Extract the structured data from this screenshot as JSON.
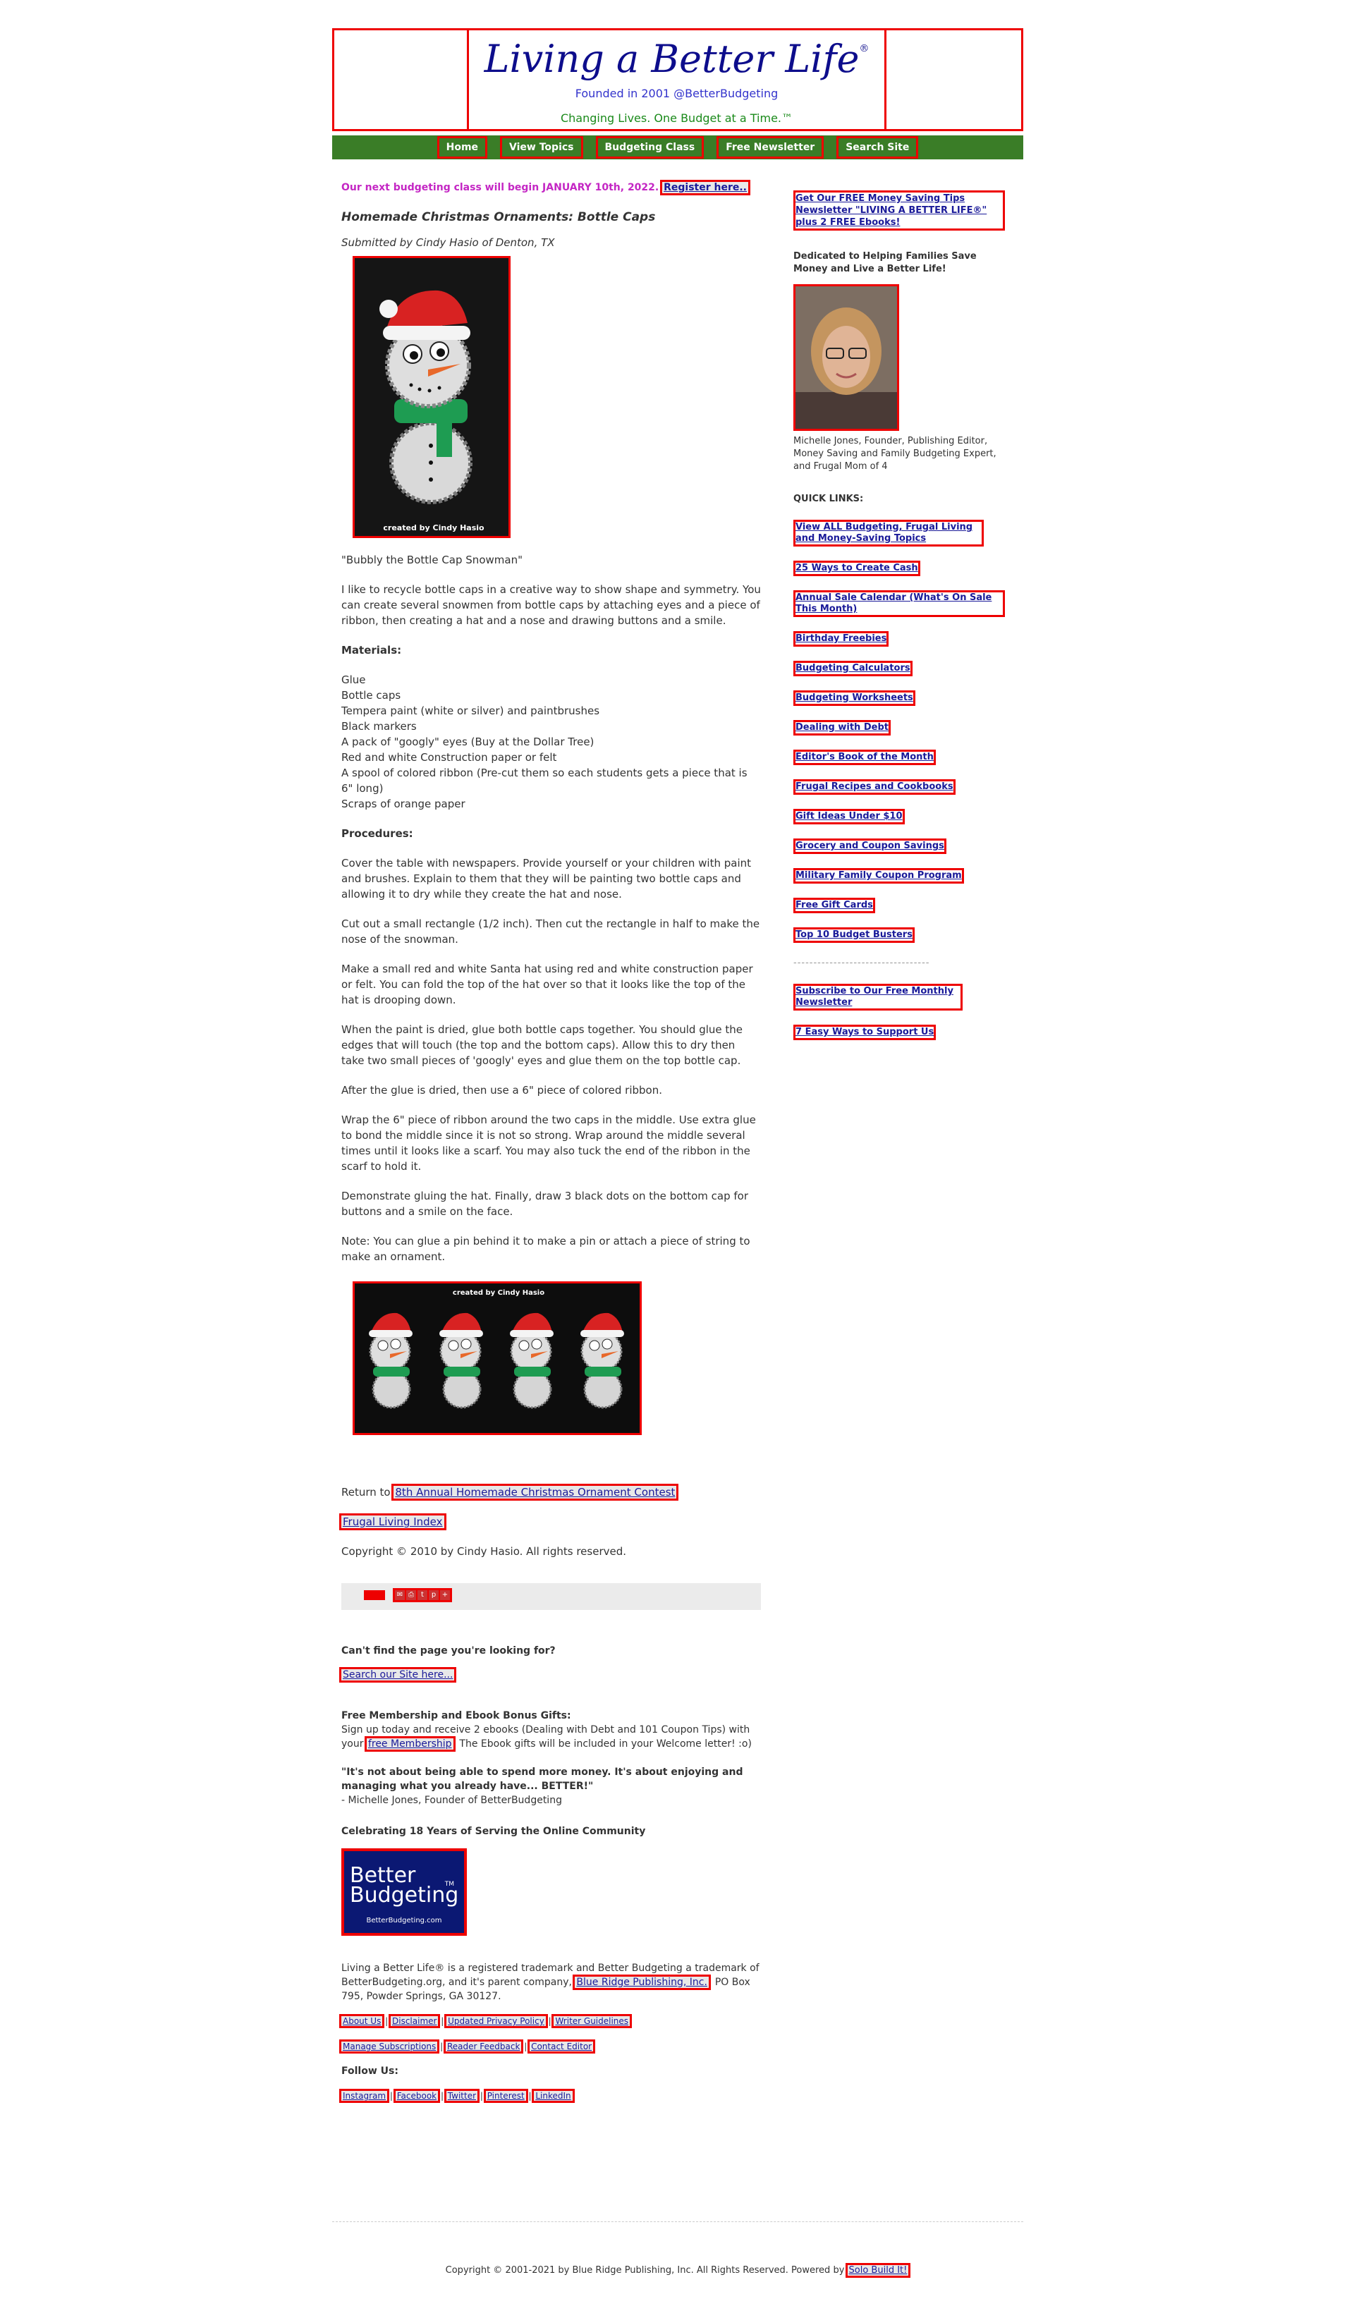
{
  "header": {
    "title": "Living a Better Life",
    "registered": "®",
    "founded": "Founded in 2001 @BetterBudgeting",
    "tagline": "Changing Lives. One Budget at a Time.™"
  },
  "nav": [
    "Home",
    "View Topics",
    "Budgeting Class",
    "Free Newsletter",
    "Search Site"
  ],
  "main": {
    "class_note": "Our next budgeting class will begin JANUARY 10th, 2022.",
    "register_link": "Register here..",
    "article_title": "Homemade Christmas Ornaments: Bottle Caps",
    "submitted": "Submitted by Cindy Hasio of Denton, TX",
    "photo1_caption": "created by Cindy Hasio",
    "intro_quote": "\"Bubbly the Bottle Cap Snowman\"",
    "intro": "I like to recycle bottle caps in a creative way to show shape and symmetry.  You can create several snowmen from bottle caps by attaching eyes and a piece of ribbon, then creating a hat and a nose and drawing buttons and a smile.",
    "materials_heading": "Materials:",
    "materials": [
      "Glue",
      "Bottle caps",
      "Tempera paint (white or silver) and paintbrushes",
      "Black markers",
      "A pack of \"googly\" eyes (Buy at the Dollar Tree)",
      "Red and white Construction paper or felt",
      "A spool of colored ribbon (Pre-cut them so each students gets a piece that is 6\" long)",
      "Scraps of orange paper"
    ],
    "procedures_heading": "Procedures:",
    "procedures": [
      "Cover the table with newspapers. Provide yourself or your children with paint and brushes. Explain to them that they will be painting two bottle caps and allowing it to dry while they create the hat and nose.",
      "Cut out a small rectangle (1/2 inch). Then cut the rectangle in half to make the nose of the snowman.",
      "Make a small red and white Santa hat using red and white construction paper or felt. You can fold the top of the hat over so that it looks like the top of the hat is drooping down.",
      "When the paint is dried,  glue both bottle caps together. You should glue the edges that will touch (the top and the bottom caps). Allow this to dry then take two small pieces of 'googly' eyes and glue them on the top bottle cap.",
      "After the glue is dried, then use a 6\" piece of colored ribbon.",
      "Wrap the 6\" piece of ribbon around the two caps in the middle. Use extra glue to bond the middle since it is not so strong. Wrap around the middle several times until it looks like a scarf. You may also tuck the end of the ribbon in the scarf to hold it.",
      "Demonstrate gluing the hat. Finally, draw 3 black dots on the bottom cap for buttons and a smile on the face.",
      "Note: You can glue a pin behind it to make a pin or attach a piece of string to make an ornament."
    ],
    "photo2_caption": "created by Cindy Hasio",
    "return_prefix": "Return to",
    "return_link": "8th Annual Homemade Christmas Ornament Contest",
    "frugal_link": "Frugal Living Index",
    "article_copyright": "Copyright © 2010 by Cindy Hasio. All rights reserved.",
    "cant_find": "Can't find the page you're looking for?",
    "search_link": "Search our Site here...",
    "membership_heading": "Free Membership and Ebook Bonus Gifts:",
    "membership_text1": "Sign up today and receive 2 ebooks (Dealing with Debt and 101 Coupon Tips) with your",
    "membership_link": "free Membership",
    "membership_text2": ". The Ebook gifts will be included in your Welcome letter! :o)",
    "quote": "\"It's not about being able to spend more money. It's about enjoying and managing what you already have... BETTER!\"",
    "quote_attrib": "- Michelle Jones, Founder of BetterBudgeting",
    "celebrating": "Celebrating 18 Years of Serving the Online Community",
    "badge_line1": "Better",
    "badge_line2": "Budgeting",
    "badge_tm": "TM",
    "badge_url": "BetterBudgeting.com",
    "trademark_text1": "Living a Better Life® is a registered trademark and Better Budgeting a trademark of BetterBudgeting.org, and it's parent company,",
    "trademark_link": "Blue Ridge Publishing, Inc.",
    "trademark_text2": ", PO Box 795, Powder Springs, GA 30127.",
    "footer_row1": [
      "About Us",
      "Disclaimer",
      "Updated Privacy Policy",
      "Writer Guidelines"
    ],
    "footer_row2": [
      "Manage Subscriptions",
      "Reader Feedback",
      "Contact Editor"
    ],
    "follow_us": "Follow Us:",
    "social": [
      "Instagram",
      "Facebook",
      "Twitter",
      "Pinterest",
      "LinkedIn"
    ]
  },
  "sidebar": {
    "newsletter_link": "Get Our FREE Money Saving Tips Newsletter \"LIVING A BETTER LIFE®\" plus 2 FREE Ebooks!",
    "dedicated": "Dedicated to Helping Families Save Money and Live a Better Life!",
    "founder_caption": "Michelle Jones, Founder, Publishing Editor, Money Saving and Family Budgeting Expert, and Frugal Mom of 4",
    "quick_links_heading": "QUICK LINKS:",
    "quick_links": [
      "View ALL Budgeting, Frugal Living and Money-Saving Topics",
      "25 Ways to Create Cash",
      "Annual Sale Calendar (What's On Sale This Month)",
      "Birthday Freebies",
      "Budgeting Calculators",
      "Budgeting Worksheets",
      "Dealing with Debt",
      "Editor's Book of the Month",
      "Frugal Recipes and Cookbooks",
      "Gift Ideas Under $10",
      "Grocery and Coupon Savings",
      "Military Family Coupon Program",
      "Free Gift Cards",
      "Top 10 Budget Busters"
    ],
    "separator": "----------------------------------",
    "subscribe_link": "Subscribe to Our Free Monthly Newsletter",
    "support_link": "7 Easy Ways to Support Us"
  },
  "footer": {
    "copyright": "Copyright © 2001-2021 by Blue Ridge Publishing, Inc. All Rights Reserved. Powered by",
    "powered_link": "Solo Build It!"
  },
  "colors": {
    "nav_green": "#3a7d27",
    "title_navy": "#0d0d8c",
    "class_magenta": "#c427c4",
    "link_blue": "#1a1a99",
    "tagline_green": "#1a8a1a"
  }
}
